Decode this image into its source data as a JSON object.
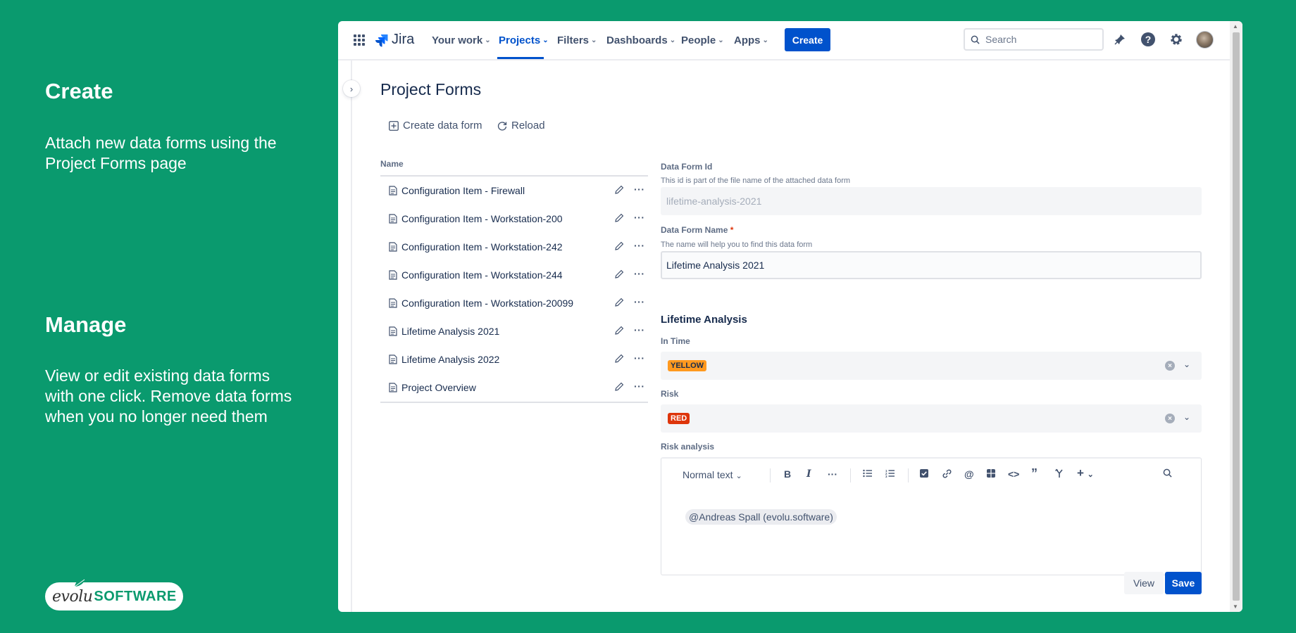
{
  "promo": {
    "create_title": "Create",
    "create_text": "Attach new data forms using the Project Forms page",
    "manage_title": "Manage",
    "manage_text": "View or edit existing data forms with one click. Remove data forms when you no longer need them",
    "logo_evolu": "evolu",
    "logo_software": "SOFTWARE"
  },
  "nav": {
    "product": "Jira",
    "items": [
      "Your work",
      "Projects",
      "Filters",
      "Dashboards",
      "People",
      "Apps"
    ],
    "active": "Projects",
    "create_label": "Create",
    "search_placeholder": "Search"
  },
  "page": {
    "title": "Project Forms",
    "create_data_form": "Create data form",
    "reload": "Reload"
  },
  "list": {
    "header": "Name",
    "items": [
      "Configuration Item - Firewall",
      "Configuration Item - Workstation-200",
      "Configuration Item - Workstation-242",
      "Configuration Item - Workstation-244",
      "Configuration Item - Workstation-20099",
      "Lifetime Analysis 2021",
      "Lifetime Analysis 2022",
      "Project Overview"
    ]
  },
  "form": {
    "id_label": "Data Form Id",
    "id_help": "This id is part of the file name of the attached data form",
    "id_value": "lifetime-analysis-2021",
    "name_label": "Data Form Name",
    "name_required": "*",
    "name_help": "The name will help you to find this data form",
    "name_value": "Lifetime Analysis 2021",
    "section_title": "Lifetime Analysis",
    "in_time_label": "In Time",
    "in_time_value": "YELLOW",
    "risk_label": "Risk",
    "risk_value": "RED",
    "risk_analysis_label": "Risk analysis",
    "editor_style": "Normal text",
    "editor_mention": "@Andreas Spall (evolu.software)",
    "view_label": "View",
    "save_label": "Save"
  },
  "colors": {
    "background": "#0a9a6e",
    "accent": "#0052cc",
    "yellow_lozenge": "#ff991f",
    "red_lozenge": "#de350b"
  }
}
